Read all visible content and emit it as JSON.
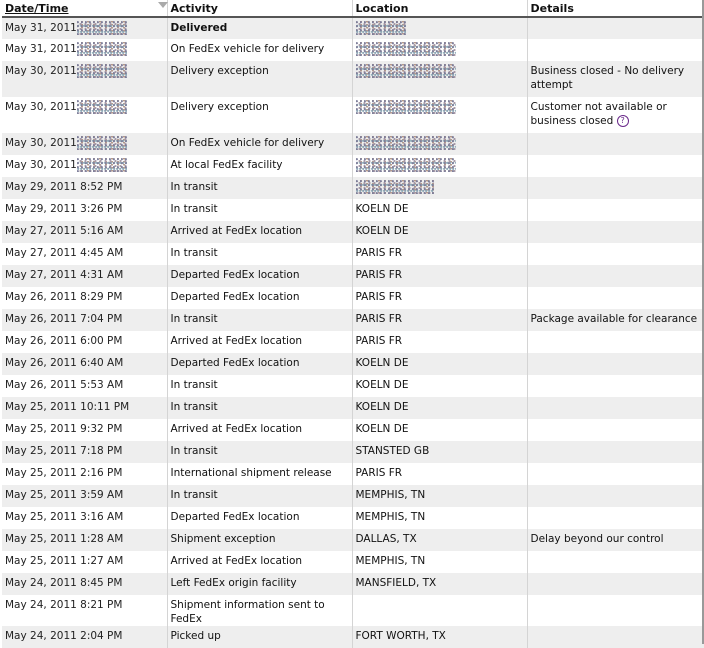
{
  "headers": {
    "datetime": "Date/Time",
    "activity": "Activity",
    "location": "Location",
    "details": "Details"
  },
  "rows": [
    {
      "date": "May 31, 2011",
      "activity": "Delivered",
      "location": "",
      "details": "",
      "date_redacted": true,
      "loc_redacted": true,
      "bold": true
    },
    {
      "date": "May 31, 2011",
      "activity": "On FedEx vehicle for delivery",
      "location": "",
      "details": "",
      "date_redacted": true,
      "loc_redacted": true
    },
    {
      "date": "May 30, 2011",
      "activity": "Delivery exception",
      "location": "",
      "details": "Business closed - No delivery attempt",
      "date_redacted": true,
      "loc_redacted": true
    },
    {
      "date": "May 30, 2011",
      "activity": "Delivery exception",
      "location": "",
      "details": "Customer not available or business closed",
      "date_redacted": true,
      "loc_redacted": true,
      "help_icon": true
    },
    {
      "date": "May 30, 2011",
      "activity": "On FedEx vehicle for delivery",
      "location": "",
      "details": "",
      "date_redacted": true,
      "loc_redacted": true
    },
    {
      "date": "May 30, 2011",
      "activity": "At local FedEx facility",
      "location": "",
      "details": "",
      "date_redacted": true,
      "loc_redacted": true
    },
    {
      "date": "May 29, 2011 8:52 PM",
      "activity": "In transit",
      "location": "",
      "details": "",
      "loc_redacted": true
    },
    {
      "date": "May 29, 2011 3:26 PM",
      "activity": "In transit",
      "location": "KOELN DE",
      "details": ""
    },
    {
      "date": "May 27, 2011 5:16 AM",
      "activity": "Arrived at FedEx location",
      "location": "KOELN DE",
      "details": ""
    },
    {
      "date": "May 27, 2011 4:45 AM",
      "activity": "In transit",
      "location": "PARIS FR",
      "details": ""
    },
    {
      "date": "May 27, 2011 4:31 AM",
      "activity": "Departed FedEx location",
      "location": "PARIS FR",
      "details": ""
    },
    {
      "date": "May 26, 2011 8:29 PM",
      "activity": "Departed FedEx location",
      "location": "PARIS FR",
      "details": ""
    },
    {
      "date": "May 26, 2011 7:04 PM",
      "activity": "In transit",
      "location": "PARIS FR",
      "details": "Package available for clearance"
    },
    {
      "date": "May 26, 2011 6:00 PM",
      "activity": "Arrived at FedEx location",
      "location": "PARIS FR",
      "details": ""
    },
    {
      "date": "May 26, 2011 6:40 AM",
      "activity": "Departed FedEx location",
      "location": "KOELN DE",
      "details": ""
    },
    {
      "date": "May 26, 2011 5:53 AM",
      "activity": "In transit",
      "location": "KOELN DE",
      "details": ""
    },
    {
      "date": "May 25, 2011 10:11 PM",
      "activity": "In transit",
      "location": "KOELN DE",
      "details": ""
    },
    {
      "date": "May 25, 2011 9:32 PM",
      "activity": "Arrived at FedEx location",
      "location": "KOELN DE",
      "details": ""
    },
    {
      "date": "May 25, 2011 7:18 PM",
      "activity": "In transit",
      "location": "STANSTED GB",
      "details": ""
    },
    {
      "date": "May 25, 2011 2:16 PM",
      "activity": "International shipment release",
      "location": "PARIS FR",
      "details": ""
    },
    {
      "date": "May 25, 2011 3:59 AM",
      "activity": "In transit",
      "location": "MEMPHIS, TN",
      "details": ""
    },
    {
      "date": "May 25, 2011 3:16 AM",
      "activity": "Departed FedEx location",
      "location": "MEMPHIS, TN",
      "details": ""
    },
    {
      "date": "May 25, 2011 1:28 AM",
      "activity": "Shipment exception",
      "location": "DALLAS, TX",
      "details": "Delay beyond our control"
    },
    {
      "date": "May 25, 2011 1:27 AM",
      "activity": "Arrived at FedEx location",
      "location": "MEMPHIS, TN",
      "details": ""
    },
    {
      "date": "May 24, 2011 8:45 PM",
      "activity": "Left FedEx origin facility",
      "location": "MANSFIELD, TX",
      "details": ""
    },
    {
      "date": "May 24, 2011 8:21 PM",
      "activity": "Shipment information sent to FedEx",
      "location": "",
      "details": ""
    },
    {
      "date": "May 24, 2011 2:04 PM",
      "activity": "Picked up",
      "location": "FORT WORTH, TX",
      "details": ""
    }
  ],
  "icons": {
    "sort": "sort-descending-icon",
    "help": "question-mark-icon"
  },
  "colors": {
    "row_alt": "#eeeeee",
    "help_icon": "#6a2a8a"
  }
}
